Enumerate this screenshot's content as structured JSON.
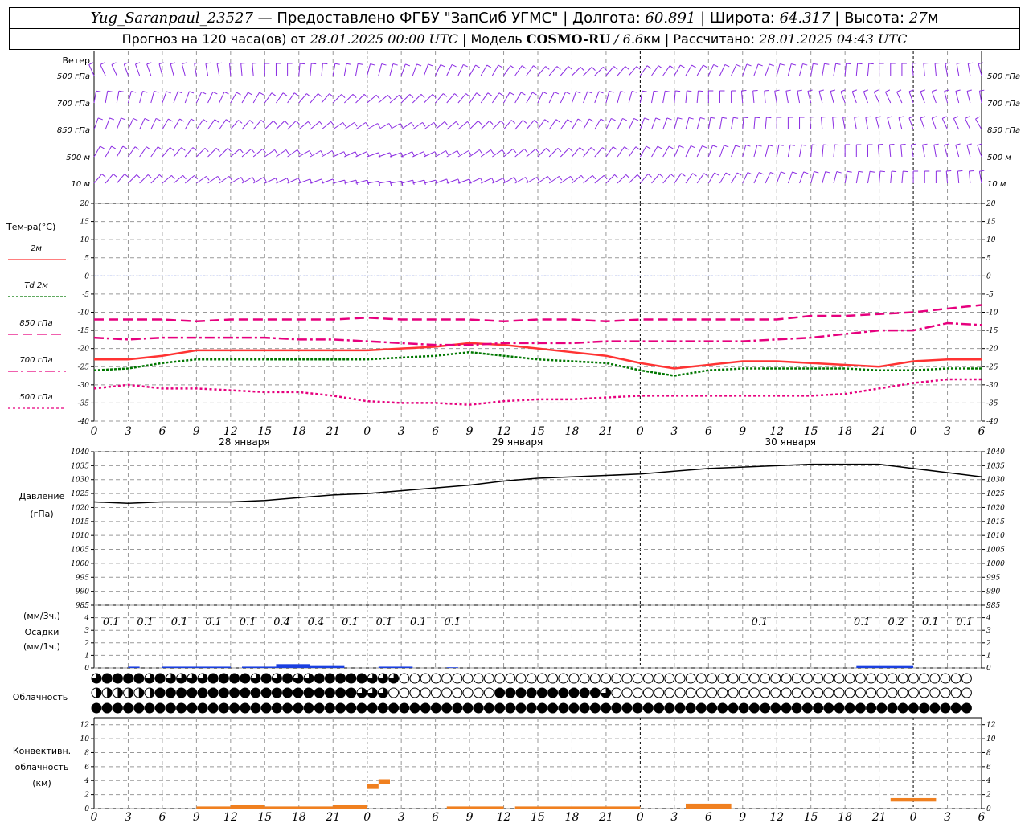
{
  "header": {
    "station": "Yug_Saranpaul_23527",
    "provider": " — Предоставлено ФГБУ \"ЗапСиб УГМС\" | Долгота: ",
    "lon": "60.891",
    "lat_label": " | Широта: ",
    "lat": "64.317",
    "alt_label": " | Высота: ",
    "alt": "27",
    "alt_unit": "м",
    "forecast_label": "Прогноз на 120 часа(ов) от ",
    "start": "28.01.2025 00:00 UTC",
    "model_label": " | Модель ",
    "model": "COSMO-RU",
    "model_res": " / 6.6",
    "model_res_unit": "км",
    "calc_label": " | Рассчитано: ",
    "calc": "28.01.2025 04:43 UTC"
  },
  "colors": {
    "wind": "#8a2be2",
    "t2m": "#ff3333",
    "td2m": "#007700",
    "t850": "#e6007e",
    "t700": "#e6007e",
    "t500": "#e6007e",
    "zero_line": "#3355ff",
    "pressure": "#000000",
    "precip": "#1a3fe0",
    "convective": "#f08020",
    "grid": "#999999"
  },
  "chart_data": [
    {
      "type": "wind-barbs",
      "ylabel": "Ветер",
      "levels": [
        "500 гПа",
        "700 гПа",
        "850 гПа",
        "500 м",
        "10 м"
      ]
    },
    {
      "type": "line",
      "ylabel": "Тем-ра(°C)",
      "ylim": [
        -40,
        20
      ],
      "yticks": [
        20,
        15,
        10,
        5,
        0,
        -5,
        -10,
        -15,
        -20,
        -25,
        -30,
        -35,
        -40
      ],
      "x_hours_step": 3,
      "x_tick_labels": [
        "0",
        "3",
        "6",
        "9",
        "12",
        "15",
        "18",
        "21",
        "0",
        "3",
        "6",
        "9",
        "12",
        "15",
        "18",
        "21",
        "0",
        "3",
        "6",
        "9",
        "12",
        "15",
        "18",
        "21",
        "0",
        "3",
        "6"
      ],
      "date_labels": [
        "28 января",
        "29 января",
        "30 января"
      ],
      "series": [
        {
          "name": "2м",
          "style": "solid",
          "x": [
            0,
            3,
            6,
            9,
            12,
            15,
            18,
            21,
            24,
            27,
            30,
            33,
            36,
            39,
            42,
            45,
            48,
            51,
            54,
            57,
            60,
            63,
            66,
            69,
            72,
            75,
            78
          ],
          "y": [
            -23,
            -23,
            -22,
            -20.5,
            -20.5,
            -20.5,
            -20.5,
            -20.5,
            -20.5,
            -20,
            -19.5,
            -18.5,
            -19,
            -20,
            -21,
            -22,
            -24,
            -25.5,
            -24.5,
            -23.5,
            -23.5,
            -24,
            -24.5,
            -25,
            -23.5,
            -23,
            -23
          ]
        },
        {
          "name": "Td 2м",
          "style": "dotted",
          "x": [
            0,
            3,
            6,
            9,
            12,
            15,
            18,
            21,
            24,
            27,
            30,
            33,
            36,
            39,
            42,
            45,
            48,
            51,
            54,
            57,
            60,
            63,
            66,
            69,
            72,
            75,
            78
          ],
          "y": [
            -26,
            -25.5,
            -24,
            -23,
            -23,
            -23,
            -23,
            -23,
            -23,
            -22.5,
            -22,
            -21,
            -22,
            -23,
            -23.5,
            -24,
            -26,
            -27.5,
            -26,
            -25.5,
            -25.5,
            -25.5,
            -25.5,
            -26,
            -26,
            -25.5,
            -25.5
          ]
        },
        {
          "name": "850 гПа",
          "style": "dashed",
          "x": [
            0,
            3,
            6,
            9,
            12,
            15,
            18,
            21,
            24,
            27,
            30,
            33,
            36,
            39,
            42,
            45,
            48,
            51,
            54,
            57,
            60,
            63,
            66,
            69,
            72,
            75,
            78
          ],
          "y": [
            -12,
            -12,
            -12,
            -12.5,
            -12,
            -12,
            -12,
            -12,
            -11.5,
            -12,
            -12,
            -12,
            -12.5,
            -12,
            -12,
            -12.5,
            -12,
            -12,
            -12,
            -12,
            -12,
            -11,
            -11,
            -10.5,
            -10,
            -9,
            -8
          ]
        },
        {
          "name": "700 гПа",
          "style": "dashdot",
          "x": [
            0,
            3,
            6,
            9,
            12,
            15,
            18,
            21,
            24,
            27,
            30,
            33,
            36,
            39,
            42,
            45,
            48,
            51,
            54,
            57,
            60,
            63,
            66,
            69,
            72,
            75,
            78
          ],
          "y": [
            -17,
            -17.5,
            -17,
            -17,
            -17,
            -17,
            -17.5,
            -17.5,
            -18,
            -18.5,
            -19,
            -19,
            -18.5,
            -18.5,
            -18.5,
            -18,
            -18,
            -18,
            -18,
            -18,
            -17.5,
            -17,
            -16,
            -15,
            -15,
            -13,
            -13.5
          ]
        },
        {
          "name": "500 гПа",
          "style": "dotted",
          "x": [
            0,
            3,
            6,
            9,
            12,
            15,
            18,
            21,
            24,
            27,
            30,
            33,
            36,
            39,
            42,
            45,
            48,
            51,
            54,
            57,
            60,
            63,
            66,
            69,
            72,
            75,
            78
          ],
          "y": [
            -31,
            -30,
            -31,
            -31,
            -31.5,
            -32,
            -32,
            -33,
            -34.5,
            -35,
            -35,
            -35.5,
            -34.5,
            -34,
            -34,
            -33.5,
            -33,
            -33,
            -33,
            -33,
            -33,
            -33,
            -32.5,
            -31,
            -29.5,
            -28.5,
            -28.5
          ]
        }
      ]
    },
    {
      "type": "line",
      "ylabel_lines": [
        "Давление",
        "(гПа)"
      ],
      "ylim": [
        985,
        1040
      ],
      "yticks": [
        1040,
        1035,
        1030,
        1025,
        1020,
        1015,
        1010,
        1005,
        1000,
        995,
        990,
        985
      ],
      "series": [
        {
          "name": "",
          "x": [
            0,
            3,
            6,
            9,
            12,
            15,
            18,
            21,
            24,
            27,
            30,
            33,
            36,
            39,
            42,
            45,
            48,
            51,
            54,
            57,
            60,
            63,
            66,
            69,
            72,
            75,
            78
          ],
          "y": [
            1022,
            1021.5,
            1022,
            1022,
            1022,
            1022.5,
            1023.5,
            1024.5,
            1025,
            1026,
            1027,
            1028,
            1029.5,
            1030.5,
            1031,
            1031.5,
            1032,
            1033,
            1034,
            1034.5,
            1035,
            1035.5,
            1035.5,
            1035.5,
            1034,
            1032.5,
            1031
          ]
        }
      ]
    },
    {
      "type": "bar",
      "ylabel_lines": [
        "(мм/3ч.)",
        "Осадки",
        "(мм/1ч.)"
      ],
      "ylim": [
        0,
        5
      ],
      "yticks": [
        5,
        4,
        3,
        2,
        1,
        0
      ],
      "labels_3h": [
        {
          "x": 1.5,
          "value": "0.1"
        },
        {
          "x": 4.5,
          "value": "0.1"
        },
        {
          "x": 7.5,
          "value": "0.1"
        },
        {
          "x": 10.5,
          "value": "0.1"
        },
        {
          "x": 13.5,
          "value": "0.1"
        },
        {
          "x": 16.5,
          "value": "0.4"
        },
        {
          "x": 19.5,
          "value": "0.4"
        },
        {
          "x": 22.5,
          "value": "0.1"
        },
        {
          "x": 25.5,
          "value": "0.1"
        },
        {
          "x": 28.5,
          "value": "0.1"
        },
        {
          "x": 31.5,
          "value": "0.1"
        },
        {
          "x": 58.5,
          "value": "0.1"
        },
        {
          "x": 67.5,
          "value": "0.1"
        },
        {
          "x": 70.5,
          "value": "0.2"
        },
        {
          "x": 73.5,
          "value": "0.1"
        },
        {
          "x": 76.5,
          "value": "0.1"
        }
      ],
      "hourly": [
        {
          "x0": 3,
          "x1": 4,
          "v": 0.1
        },
        {
          "x0": 6,
          "x1": 12,
          "v": 0.1
        },
        {
          "x0": 13,
          "x1": 16,
          "v": 0.1
        },
        {
          "x0": 16,
          "x1": 19,
          "v": 0.3
        },
        {
          "x0": 19,
          "x1": 22,
          "v": 0.15
        },
        {
          "x0": 25,
          "x1": 28,
          "v": 0.1
        },
        {
          "x0": 31,
          "x1": 32,
          "v": 0.05
        },
        {
          "x0": 67,
          "x1": 72,
          "v": 0.15
        }
      ]
    },
    {
      "type": "cloud-symbols",
      "ylabel": "Облачность",
      "rows": [
        "low-level",
        "mid-level",
        "high-level"
      ],
      "cover": [
        "34444343333444434343344444333000000000000000000000000000000000000000000000000000000",
        "22222244444444444444444443330000000000444444444430000000000000000000000000000000000",
        "44444444444444444444444444444444444444444444444444444444444444444444444444444444444"
      ]
    },
    {
      "type": "bar",
      "ylabel_lines": [
        "Конвективн.",
        "облачность",
        "(км)"
      ],
      "ylim": [
        0,
        13
      ],
      "yticks": [
        12,
        10,
        8,
        6,
        4,
        2,
        0
      ],
      "segments": [
        {
          "x0": 9,
          "x1": 12,
          "base": 0,
          "top": 0.3
        },
        {
          "x0": 12,
          "x1": 15,
          "base": 0,
          "top": 0.5
        },
        {
          "x0": 15,
          "x1": 21,
          "base": 0,
          "top": 0.3
        },
        {
          "x0": 21,
          "x1": 24,
          "base": 0,
          "top": 0.5
        },
        {
          "x0": 24,
          "x1": 25,
          "base": 2.8,
          "top": 3.5
        },
        {
          "x0": 25,
          "x1": 26,
          "base": 3.5,
          "top": 4.2
        },
        {
          "x0": 31,
          "x1": 36,
          "base": 0,
          "top": 0.3
        },
        {
          "x0": 37,
          "x1": 48,
          "base": 0,
          "top": 0.3
        },
        {
          "x0": 52,
          "x1": 56,
          "base": 0,
          "top": 0.7
        },
        {
          "x0": 70,
          "x1": 74,
          "base": 1.0,
          "top": 1.5
        }
      ]
    }
  ]
}
